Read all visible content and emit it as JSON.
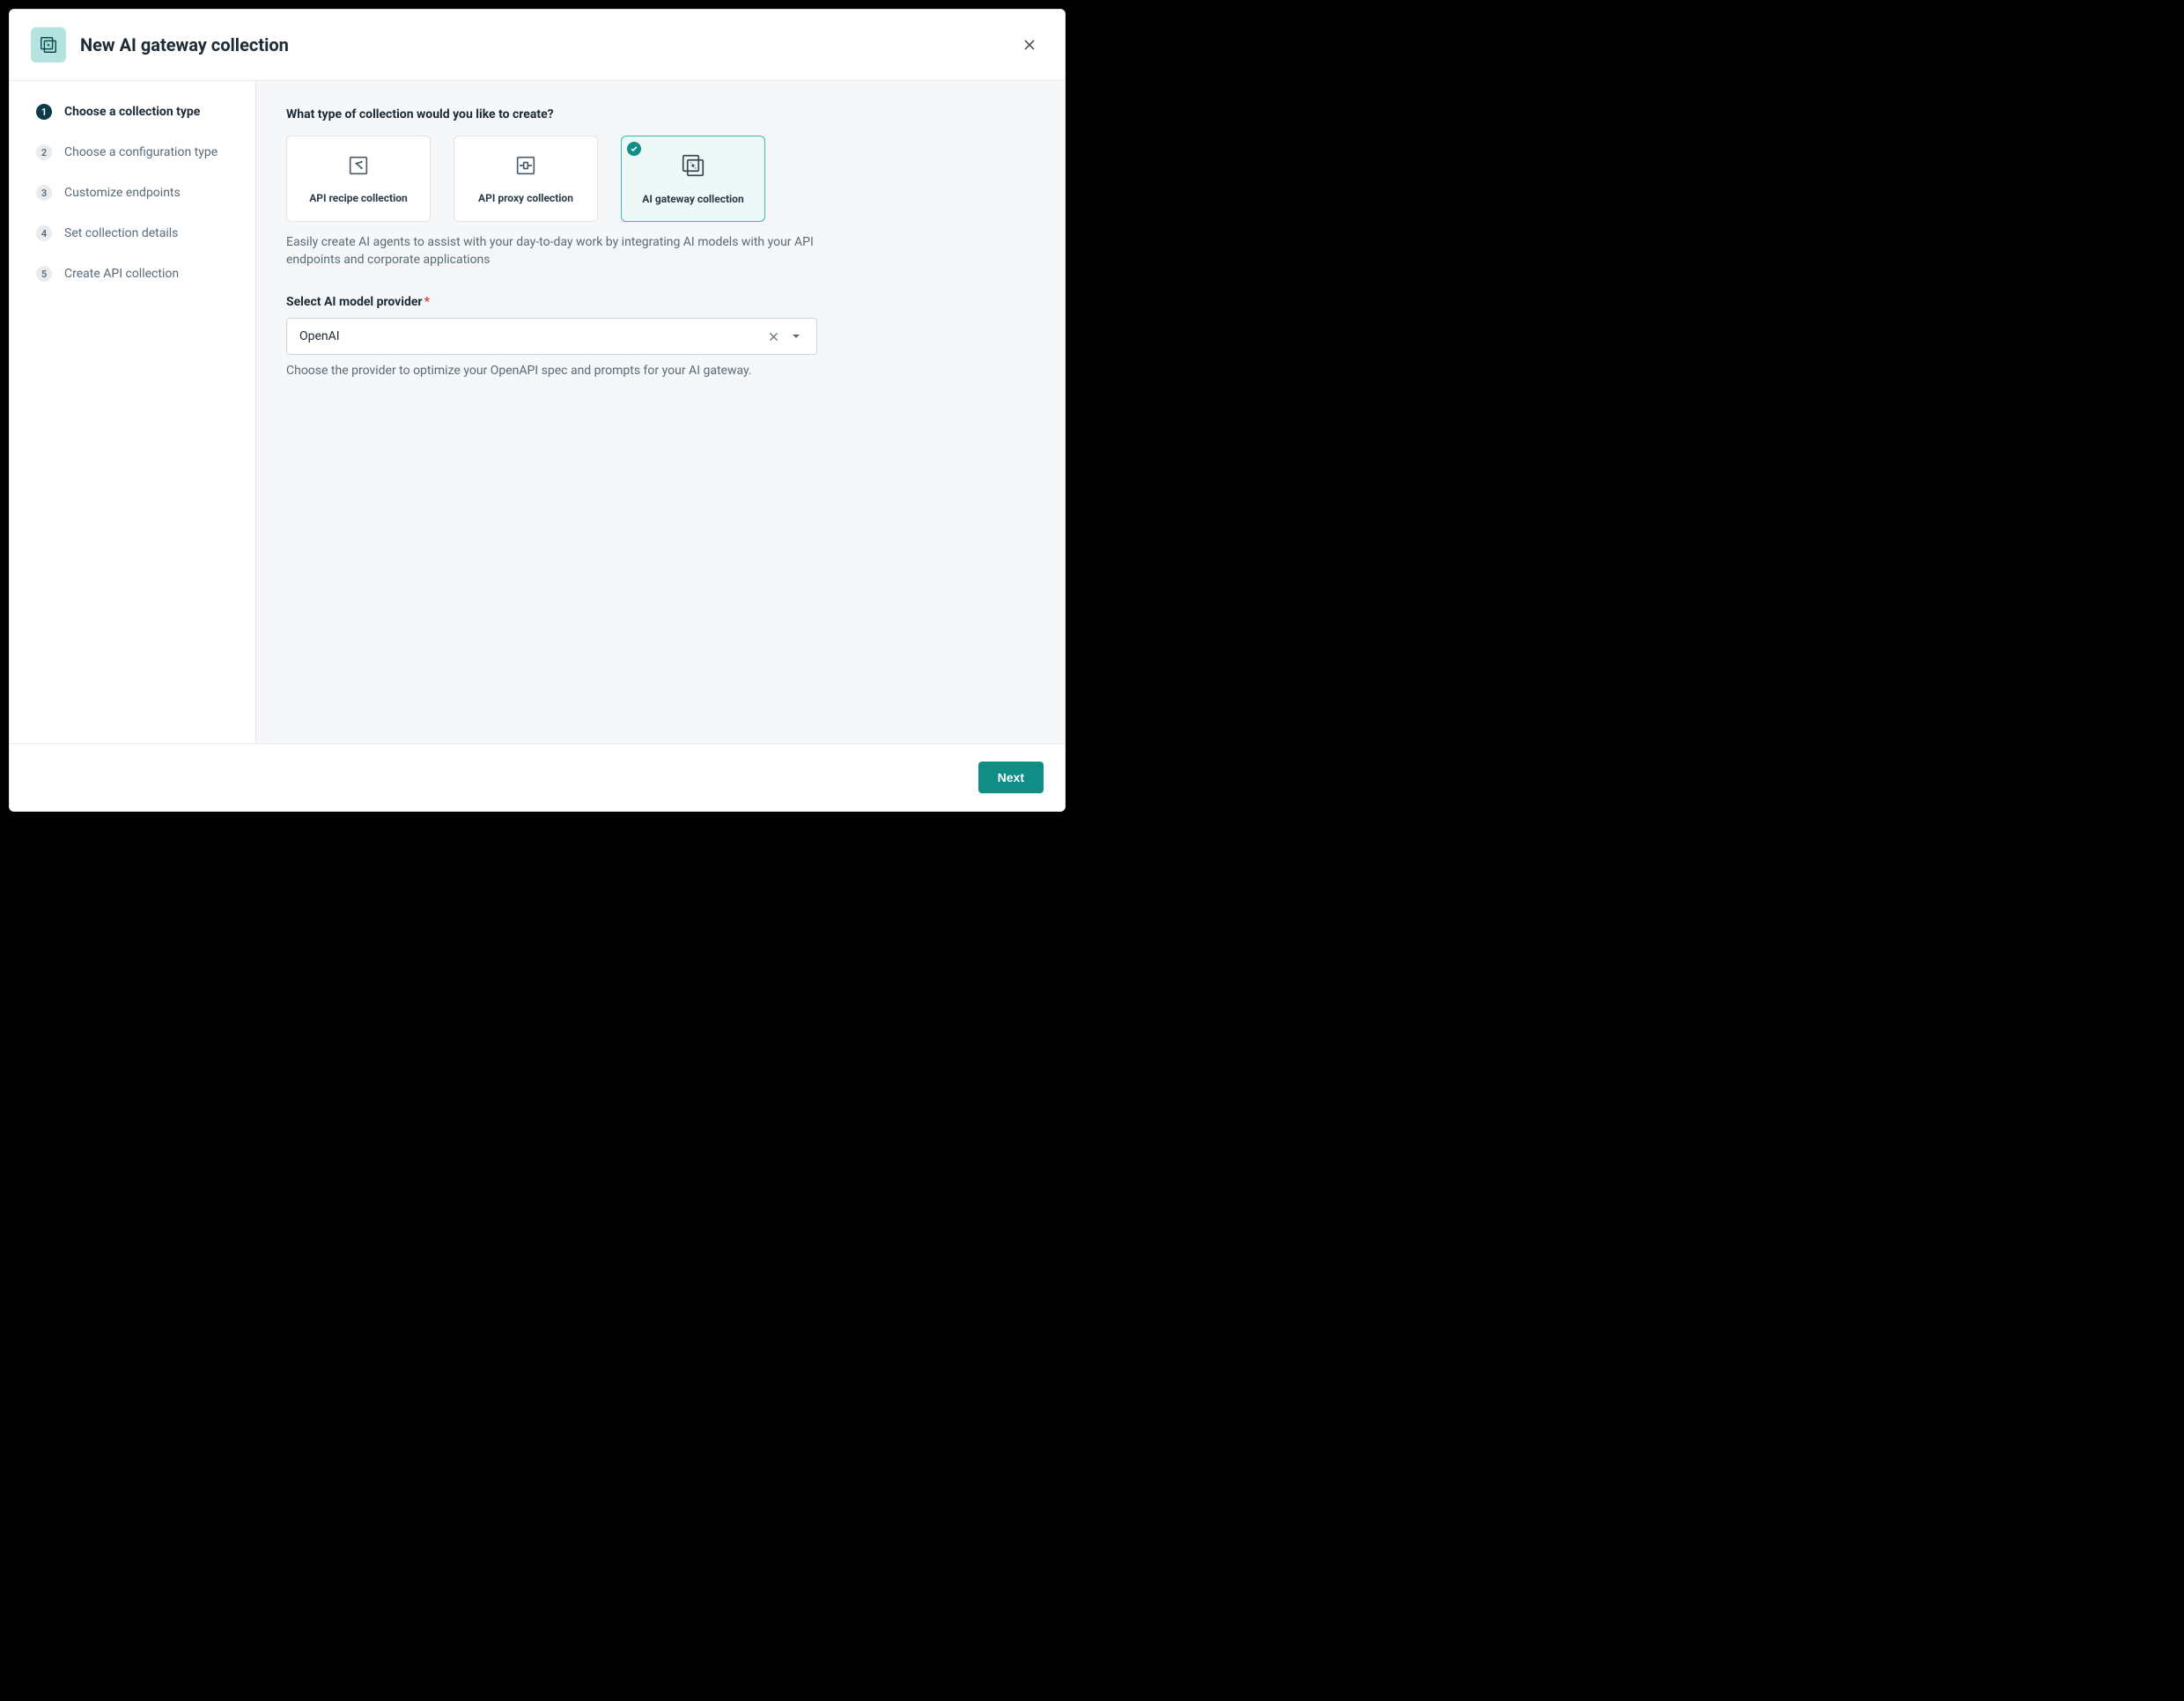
{
  "header": {
    "title": "New AI gateway collection"
  },
  "sidebar": {
    "steps": [
      {
        "num": "1",
        "label": "Choose a collection type",
        "active": true
      },
      {
        "num": "2",
        "label": "Choose a configuration type",
        "active": false
      },
      {
        "num": "3",
        "label": "Customize endpoints",
        "active": false
      },
      {
        "num": "4",
        "label": "Set collection details",
        "active": false
      },
      {
        "num": "5",
        "label": "Create API collection",
        "active": false
      }
    ]
  },
  "main": {
    "question": "What type of collection would you like to create?",
    "cards": [
      {
        "key": "recipe",
        "label": "API recipe collection",
        "selected": false
      },
      {
        "key": "proxy",
        "label": "API proxy collection",
        "selected": false
      },
      {
        "key": "gateway",
        "label": "AI gateway collection",
        "selected": true
      }
    ],
    "description": "Easily create AI agents to assist with your day-to-day work by integrating AI models with your API endpoints and corporate applications",
    "provider_label": "Select AI model provider",
    "provider_required": "*",
    "provider_value": "OpenAI",
    "provider_helper": "Choose the provider to optimize your OpenAPI spec and prompts for your AI gateway."
  },
  "footer": {
    "next": "Next"
  }
}
